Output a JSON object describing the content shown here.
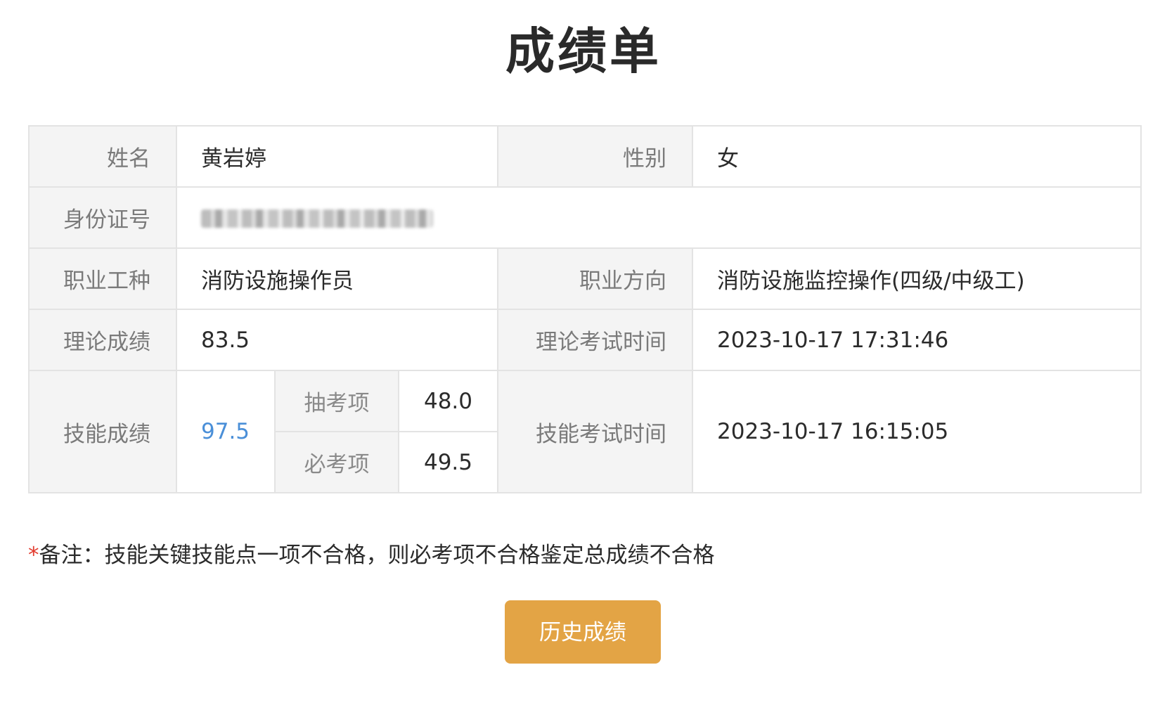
{
  "page": {
    "title": "成绩单"
  },
  "colors": {
    "label_bg": "#f4f4f4",
    "border": "#e3e3e3",
    "skill_score": "#4a8fd8",
    "button_bg": "#e3a445",
    "remark_star": "#e23b2e"
  },
  "info": {
    "name_label": "姓名",
    "name_value": "黄岩婷",
    "gender_label": "性别",
    "gender_value": "女",
    "id_label": "身份证号",
    "occupation_label": "职业工种",
    "occupation_value": "消防设施操作员",
    "direction_label": "职业方向",
    "direction_value": "消防设施监控操作(四级/中级工)",
    "theory_label": "理论成绩",
    "theory_value": "83.5",
    "theory_time_label": "理论考试时间",
    "theory_time_value": "2023-10-17 17:31:46",
    "skill_label": "技能成绩",
    "skill_value": "97.5",
    "random_item_label": "抽考项",
    "random_item_value": "48.0",
    "required_item_label": "必考项",
    "required_item_value": "49.5",
    "skill_time_label": "技能考试时间",
    "skill_time_value": "2023-10-17 16:15:05"
  },
  "remark": {
    "star": "*",
    "text": "备注：技能关键技能点一项不合格，则必考项不合格鉴定总成绩不合格"
  },
  "actions": {
    "history_label": "历史成绩"
  }
}
